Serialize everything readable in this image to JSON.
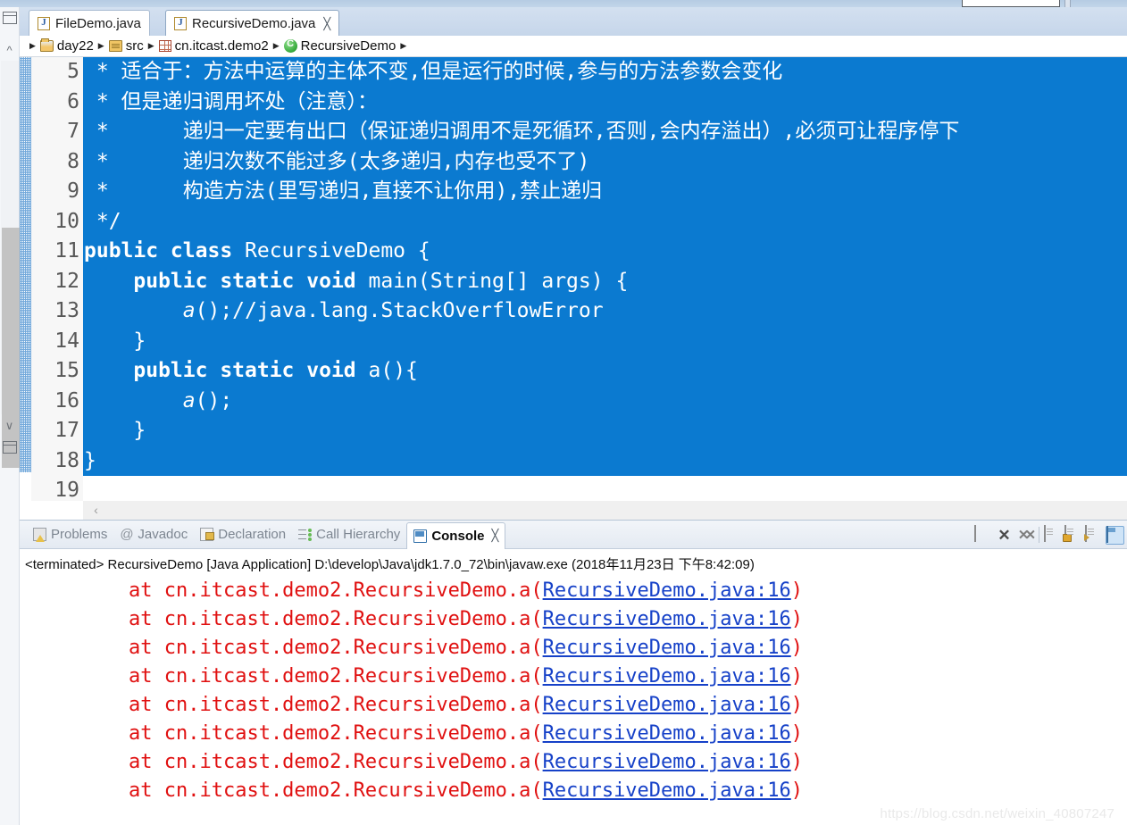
{
  "window": {
    "left_rail_icons": [
      "minimized-view-icon",
      "minimized-view-icon"
    ]
  },
  "editor_tabs": [
    {
      "label": "FileDemo.java",
      "icon": "java-file-icon",
      "active": false,
      "closable": false
    },
    {
      "label": "RecursiveDemo.java",
      "icon": "java-file-icon",
      "active": true,
      "closable": true,
      "close_glyph": "╳"
    }
  ],
  "breadcrumb": {
    "separator": "▶",
    "items": [
      {
        "label": "day22",
        "icon": "open-folder-icon"
      },
      {
        "label": "src",
        "icon": "package-root-icon"
      },
      {
        "label": "cn.itcast.demo2",
        "icon": "package-icon"
      },
      {
        "label": "RecursiveDemo",
        "icon": "java-class-icon"
      }
    ]
  },
  "code": {
    "lines": [
      {
        "num": "5",
        "selected": true,
        "segments": [
          {
            "t": " * 适合于：方法中运算的主体不变,但是运行的时候,参与的方法参数会变化"
          }
        ]
      },
      {
        "num": "6",
        "selected": true,
        "segments": [
          {
            "t": " * 但是递归调用坏处（注意）："
          }
        ]
      },
      {
        "num": "7",
        "selected": true,
        "segments": [
          {
            "t": " *      递归一定要有出口（保证递归调用不是死循环,否则,会内存溢出）,必须可让程序停下"
          }
        ]
      },
      {
        "num": "8",
        "selected": true,
        "segments": [
          {
            "t": " *      递归次数不能过多(太多递归,内存也受不了)"
          }
        ]
      },
      {
        "num": "9",
        "selected": true,
        "segments": [
          {
            "t": " *      构造方法(里写递归,直接不让你用),禁止递归"
          }
        ]
      },
      {
        "num": "10",
        "selected": true,
        "segments": [
          {
            "t": " */"
          }
        ]
      },
      {
        "num": "11",
        "selected": true,
        "segments": [
          {
            "t": "public class ",
            "s": "kw"
          },
          {
            "t": "RecursiveDemo {"
          }
        ]
      },
      {
        "num": "12",
        "selected": true,
        "segments": [
          {
            "t": "    public static void ",
            "s": "kw"
          },
          {
            "t": "main(String[] args) {"
          }
        ]
      },
      {
        "num": "13",
        "selected": true,
        "segments": [
          {
            "t": "        "
          },
          {
            "t": "a",
            "s": "it"
          },
          {
            "t": "();//java.lang.StackOverflowError"
          }
        ]
      },
      {
        "num": "14",
        "selected": true,
        "segments": [
          {
            "t": "    }"
          }
        ]
      },
      {
        "num": "15",
        "selected": true,
        "segments": [
          {
            "t": "    public static void ",
            "s": "kw"
          },
          {
            "t": "a(){"
          }
        ]
      },
      {
        "num": "16",
        "selected": true,
        "segments": [
          {
            "t": "        "
          },
          {
            "t": "a",
            "s": "it"
          },
          {
            "t": "();"
          }
        ]
      },
      {
        "num": "17",
        "selected": true,
        "segments": [
          {
            "t": "    }"
          }
        ]
      },
      {
        "num": "18",
        "selected": true,
        "segments": [
          {
            "t": "}"
          }
        ]
      },
      {
        "num": "19",
        "selected": false,
        "segments": [
          {
            "t": ""
          }
        ]
      }
    ],
    "selection_color": "#0b7ad0",
    "scroll_left_arrow": "‹"
  },
  "view_tabs": [
    {
      "label": "Problems",
      "icon": "problems-icon",
      "active": false
    },
    {
      "label": "Javadoc",
      "icon": "javadoc-at-icon",
      "active": false
    },
    {
      "label": "Declaration",
      "icon": "declaration-icon",
      "active": false
    },
    {
      "label": "Call Hierarchy",
      "icon": "call-hierarchy-icon",
      "active": false
    },
    {
      "label": "Console",
      "icon": "console-icon",
      "active": true,
      "close_glyph": "╳"
    }
  ],
  "console_toolbar": [
    {
      "name": "terminate-button",
      "icon": "stop-square-icon"
    },
    {
      "name": "remove-launch-button",
      "icon": "close-x-icon"
    },
    {
      "name": "remove-all-launches-button",
      "icon": "close-all-xx-icon"
    },
    {
      "name": "toolbar-separator",
      "icon": "separator"
    },
    {
      "name": "clear-console-button",
      "icon": "clear-console-icon"
    },
    {
      "name": "scroll-lock-button",
      "icon": "lock-icon"
    },
    {
      "name": "word-wrap-button",
      "icon": "doc-arrow-icon"
    },
    {
      "name": "pin-console-button",
      "icon": "pin-console-icon",
      "active": true
    }
  ],
  "console": {
    "terminated_line": "<terminated> RecursiveDemo [Java Application] D:\\develop\\Java\\jdk1.7.0_72\\bin\\javaw.exe (2018年11月23日 下午8:42:09)",
    "trace_prefix": "at cn.itcast.demo2.RecursiveDemo.a(",
    "trace_link": "RecursiveDemo.java:16",
    "trace_suffix": ")",
    "trace_count": 8,
    "text_color": "#e01010",
    "link_color": "#1641c8"
  },
  "watermark": "https://blog.csdn.net/weixin_40807247"
}
